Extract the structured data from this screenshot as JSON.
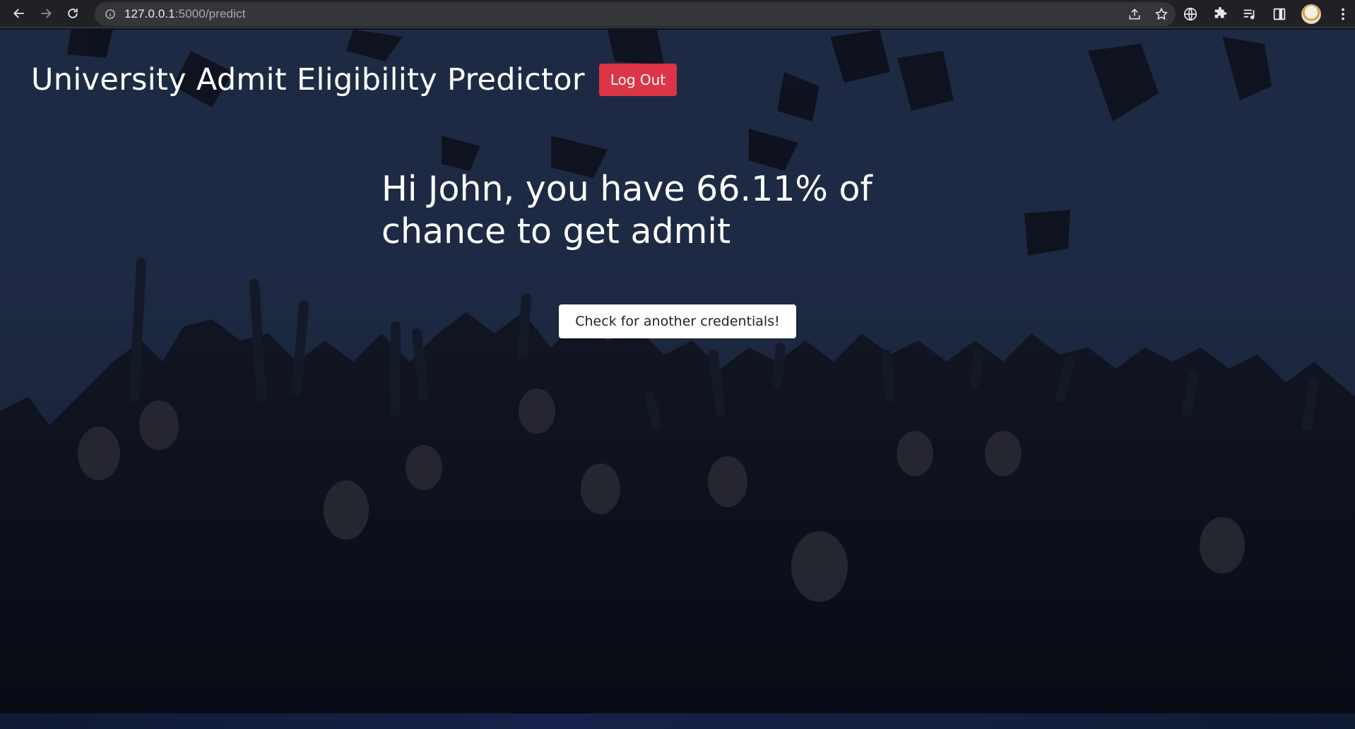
{
  "browser": {
    "url_host": "127.0.0.1",
    "url_path": ":5000/predict"
  },
  "header": {
    "title": "University Admit Eligibility Predictor",
    "logout_label": "Log Out"
  },
  "result": {
    "message": "Hi John, you have 66.11% of chance to get admit"
  },
  "actions": {
    "check_again_label": "Check for another credentials!"
  },
  "colors": {
    "logout_bg": "#dc3545",
    "chrome_bg": "#202124"
  }
}
